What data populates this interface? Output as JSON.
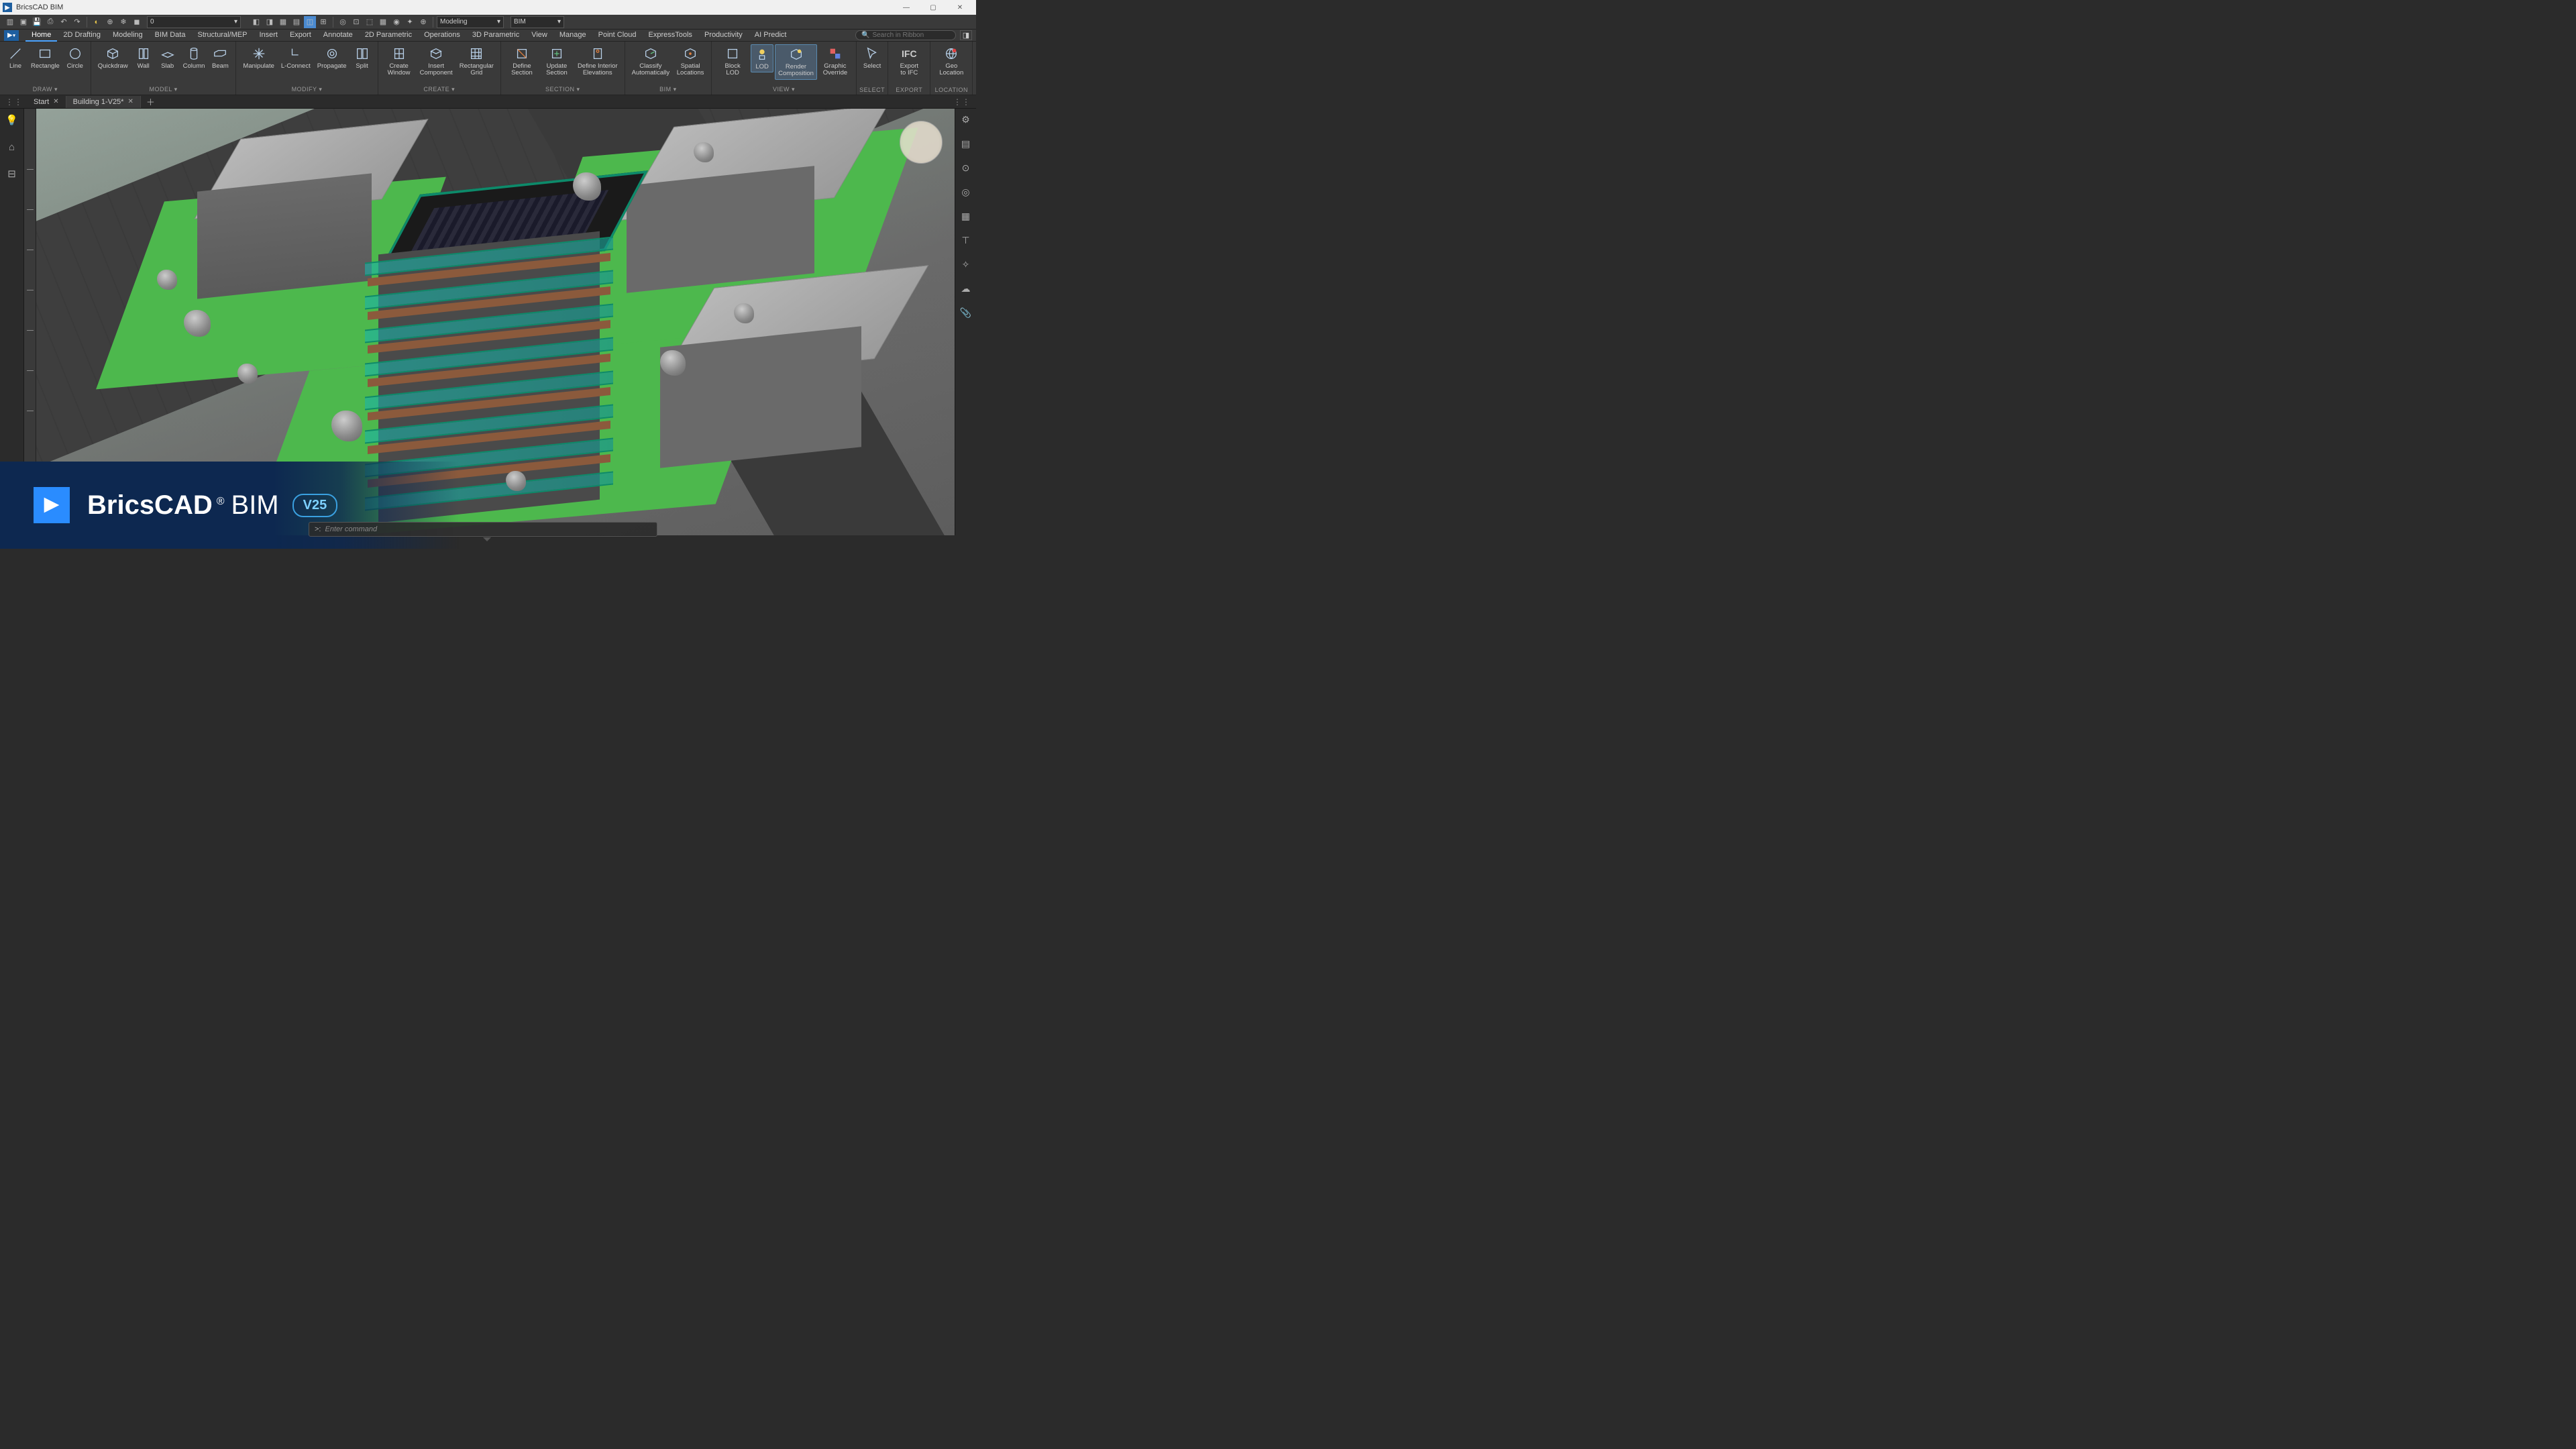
{
  "app": {
    "title": "BricsCAD BIM"
  },
  "window": {
    "minimize": "—",
    "maximize": "▢",
    "close": "✕"
  },
  "qat": {
    "layer_value": "0",
    "workspace1": "Modeling",
    "workspace2": "BIM"
  },
  "menubar": {
    "items": [
      "Home",
      "2D Drafting",
      "Modeling",
      "BIM Data",
      "Structural/MEP",
      "Insert",
      "Export",
      "Annotate",
      "2D Parametric",
      "Operations",
      "3D Parametric",
      "View",
      "Manage",
      "Point Cloud",
      "ExpressTools",
      "Productivity",
      "AI Predict"
    ],
    "active": "Home",
    "search_placeholder": "Search in Ribbon"
  },
  "ribbon": {
    "groups": [
      {
        "label": "DRAW ▾",
        "tools": [
          {
            "name": "Line",
            "icon": "line"
          },
          {
            "name": "Rectangle",
            "icon": "rect"
          },
          {
            "name": "Circle",
            "icon": "circle"
          }
        ]
      },
      {
        "label": "MODEL ▾",
        "tools": [
          {
            "name": "Quickdraw",
            "icon": "cube"
          },
          {
            "name": "Wall",
            "icon": "wall"
          },
          {
            "name": "Slab",
            "icon": "slab"
          },
          {
            "name": "Column",
            "icon": "column"
          },
          {
            "name": "Beam",
            "icon": "beam"
          }
        ]
      },
      {
        "label": "MODIFY ▾",
        "tools": [
          {
            "name": "Manipulate",
            "icon": "manip"
          },
          {
            "name": "L-Connect",
            "icon": "lconn"
          },
          {
            "name": "Propagate",
            "icon": "prop"
          },
          {
            "name": "Split",
            "icon": "split"
          }
        ]
      },
      {
        "label": "CREATE ▾",
        "tools": [
          {
            "name": "Create\nWindow",
            "icon": "win"
          },
          {
            "name": "Insert\nComponent",
            "icon": "comp"
          },
          {
            "name": "Rectangular\nGrid",
            "icon": "grid"
          }
        ]
      },
      {
        "label": "SECTION ▾",
        "tools": [
          {
            "name": "Define\nSection",
            "icon": "dsec"
          },
          {
            "name": "Update\nSection",
            "icon": "usec"
          },
          {
            "name": "Define Interior\nElevations",
            "icon": "elev"
          }
        ]
      },
      {
        "label": "BIM ▾",
        "tools": [
          {
            "name": "Classify\nAutomatically",
            "icon": "class"
          },
          {
            "name": "Spatial\nLocations",
            "icon": "spat"
          }
        ]
      },
      {
        "label": "VIEW ▾",
        "tools": [
          {
            "name": "Block\nLOD",
            "icon": "blod"
          },
          {
            "name": "LOD",
            "icon": "lod",
            "active": true
          },
          {
            "name": "Render\nComposition",
            "icon": "rcomp",
            "active": true
          },
          {
            "name": "Graphic\nOverride",
            "icon": "gover"
          }
        ]
      },
      {
        "label": "SELECT",
        "tools": [
          {
            "name": "Select",
            "icon": "cursor"
          }
        ]
      },
      {
        "label": "EXPORT",
        "tools": [
          {
            "name": "Export\nto IFC",
            "icon": "ifc"
          }
        ]
      },
      {
        "label": "LOCATION",
        "tools": [
          {
            "name": "Geo\nLocation",
            "icon": "geo"
          }
        ]
      }
    ]
  },
  "tabs": [
    {
      "label": "Start",
      "closable": true,
      "active": false
    },
    {
      "label": "Building 1-V25*",
      "closable": true,
      "active": true
    }
  ],
  "cmdline": {
    "prompt": ">:",
    "placeholder": "Enter command"
  },
  "marketing": {
    "brand1": "BricsCAD",
    "reg": "®",
    "brand2": "BIM",
    "version": "V25"
  }
}
